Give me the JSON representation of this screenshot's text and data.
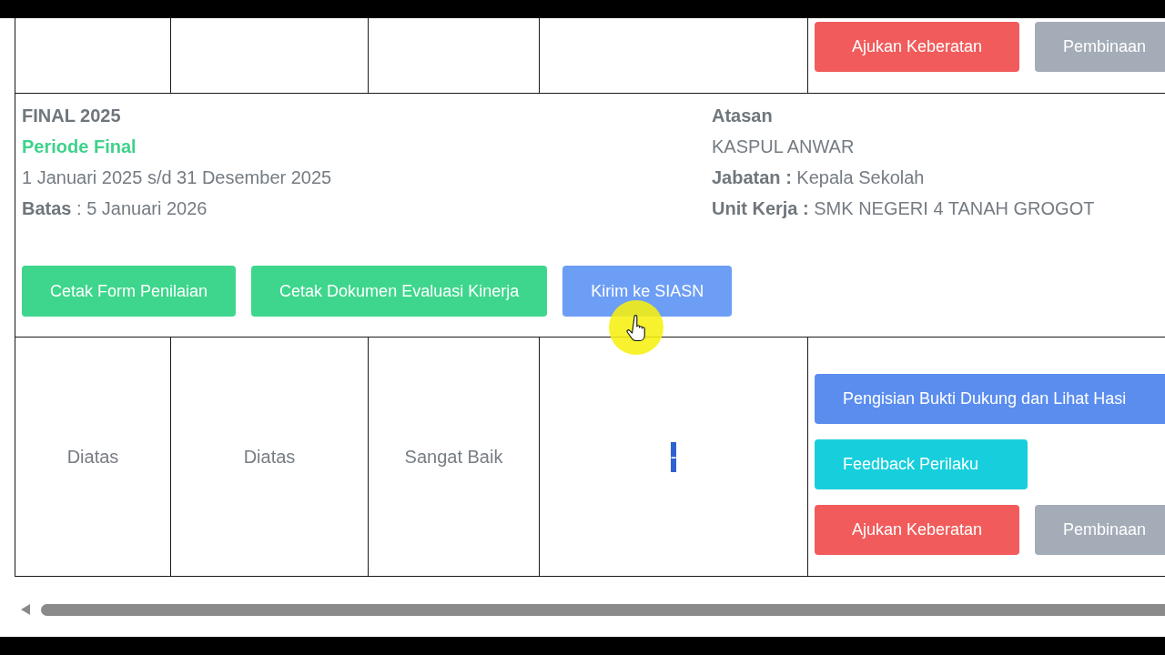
{
  "table": {
    "rows": [
      {
        "kind": "scores",
        "action_rows": [
          {
            "buttons": [
              {
                "label": "Ajukan Keberatan",
                "kind": "danger",
                "hovered": false
              },
              {
                "label": "Pembinaan",
                "kind": "secondary",
                "hovered": false
              }
            ]
          }
        ]
      },
      {
        "kind": "period",
        "title": "FINAL 2025",
        "status": "Periode Final",
        "range": "1 Januari 2025 s/d 31 Desember 2025",
        "deadline": "**Batas** : 5 Januari 2026",
        "supervisor": {
          "heading": "Atasan",
          "name": "KASPUL ANWAR",
          "position": "**Jabatan :** Kepala Sekolah",
          "unit": "**Unit Kerja :** SMK NEGERI 4 TANAH GROGOT"
        },
        "buttons": [
          {
            "label": "Cetak Form Penilaian",
            "kind": "success",
            "hovered": false
          },
          {
            "label": "Cetak Dokumen Evaluasi Kinerja",
            "kind": "success",
            "hovered": false
          },
          {
            "label": "Kirim ke SIASN",
            "kind": "primary",
            "hovered": true
          }
        ]
      },
      {
        "kind": "scores",
        "cells": [
          {
            "text": "Diatas",
            "highlighted": false
          },
          {
            "text": "Diatas",
            "highlighted": false
          },
          {
            "text": "Sangat Baik",
            "highlighted": false
          },
          {
            "text": "-",
            "highlighted": true
          }
        ],
        "action_rows": [
          {
            "buttons": [
              {
                "label": "Pengisian Bukti Dukung dan Lihat Hasi",
                "kind": "primary",
                "hovered": false
              }
            ]
          },
          {
            "buttons": [
              {
                "label": "Feedback Perilaku",
                "kind": "info",
                "hovered": false
              }
            ]
          },
          {
            "buttons": [
              {
                "label": "Ajukan Keberatan",
                "kind": "danger",
                "hovered": false
              },
              {
                "label": "Pembinaan",
                "kind": "secondary",
                "hovered": false
              }
            ]
          }
        ]
      }
    ]
  }
}
